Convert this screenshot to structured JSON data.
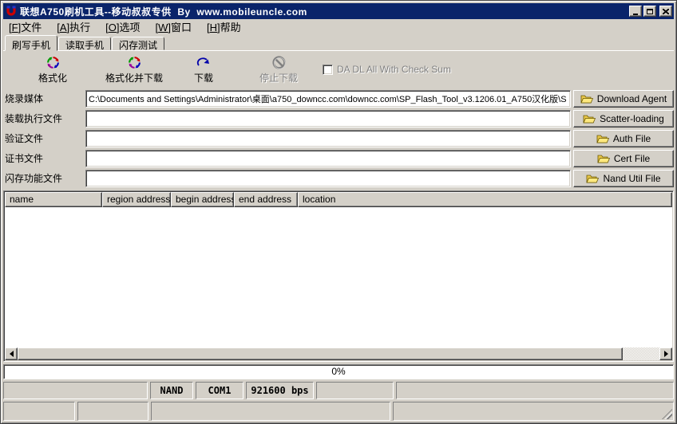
{
  "colors": {
    "titlebar": "#0a246a",
    "face": "#d4d0c8",
    "disabled_text": "#808080",
    "folder_icon": "#ffe97f"
  },
  "window": {
    "title": "联想A750刷机工具--移动叔叔专供  By  www.mobileuncle.com",
    "icons": [
      "app-icon",
      "minimize-icon",
      "maximize-icon",
      "close-icon"
    ]
  },
  "menu": {
    "items": [
      {
        "pre": "[",
        "key": "F",
        "post": "]文件"
      },
      {
        "pre": "[",
        "key": "A",
        "post": "]执行"
      },
      {
        "pre": "[",
        "key": "O",
        "post": "]选项"
      },
      {
        "pre": "[",
        "key": "W",
        "post": "]窗口"
      },
      {
        "pre": "[",
        "key": "H",
        "post": "]帮助"
      }
    ]
  },
  "tabs": [
    {
      "label": "刷写手机",
      "active": true
    },
    {
      "label": "读取手机",
      "active": false
    },
    {
      "label": "闪存测试",
      "active": false
    }
  ],
  "toolbar": {
    "buttons": [
      {
        "label": "格式化",
        "icon": "format-icon",
        "disabled": false
      },
      {
        "label": "格式化并下载",
        "icon": "format-download-icon",
        "disabled": false
      },
      {
        "label": "下载",
        "icon": "download-icon",
        "disabled": false
      },
      {
        "label": "停止下载",
        "icon": "stop-download-icon",
        "disabled": true
      }
    ],
    "checkbox": {
      "label": "DA DL All With Check Sum",
      "checked": false,
      "disabled": true
    }
  },
  "form": {
    "rows": [
      {
        "label": "烧录媒体",
        "value": "C:\\Documents and Settings\\Administrator\\桌面\\a750_downcc.com\\downcc.com\\SP_Flash_Tool_v3.1206.01_A750汉化版\\S",
        "button": "Download Agent"
      },
      {
        "label": "装载执行文件",
        "value": "",
        "button": "Scatter-loading"
      },
      {
        "label": "验证文件",
        "value": "",
        "button": "Auth File"
      },
      {
        "label": "证书文件",
        "value": "",
        "button": "Cert File"
      },
      {
        "label": "闪存功能文件",
        "value": "",
        "button": "Nand Util File"
      }
    ]
  },
  "table": {
    "columns": [
      "name",
      "region address",
      "begin address",
      "end address",
      "location"
    ],
    "rows": []
  },
  "progress": {
    "label": "0%"
  },
  "statusbar": {
    "row1": [
      "",
      "NAND",
      "COM1",
      "921600 bps",
      "",
      ""
    ],
    "row2": [
      "",
      "",
      "",
      ""
    ]
  }
}
